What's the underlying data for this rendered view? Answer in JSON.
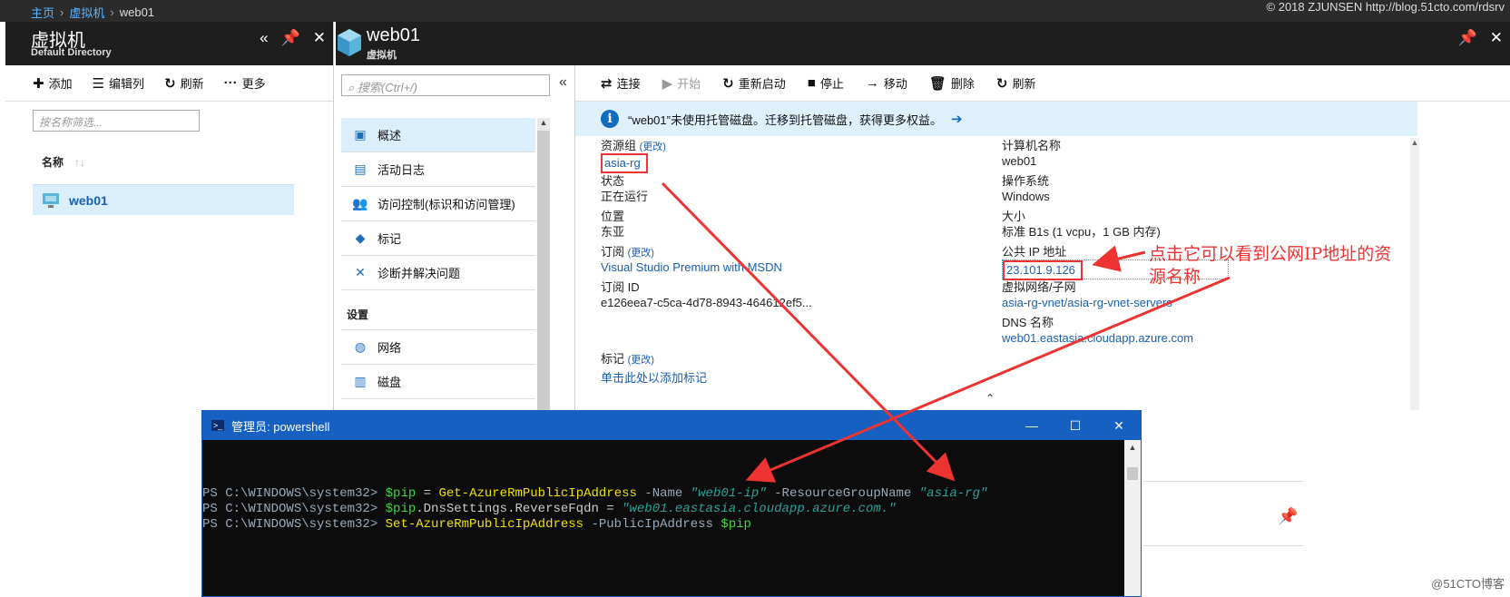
{
  "breadcrumb": [
    "主页",
    "虚拟机",
    "web01"
  ],
  "watermark_top": "© 2018 ZJUNSEN http://blog.51cto.com/rdsrv",
  "vm_list_blade": {
    "title": "虚拟机",
    "subtitle": "Default Directory",
    "toolbar": [
      {
        "icon": "plus-icon",
        "glyph": "✚",
        "label": "添加"
      },
      {
        "icon": "columns-icon",
        "glyph": "☰",
        "label": "编辑列"
      },
      {
        "icon": "refresh-icon",
        "glyph": "↻",
        "label": "刷新"
      },
      {
        "icon": "more-icon",
        "glyph": "···",
        "label": "更多"
      }
    ],
    "filter_placeholder": "按名称筛选...",
    "column_header": "名称",
    "sort_glyph": "↑↓",
    "rows": [
      {
        "name": "web01"
      }
    ]
  },
  "vm_blade": {
    "title": "web01",
    "subtitle": "虚拟机",
    "search_placeholder": "搜索(Ctrl+/)",
    "menu": [
      {
        "icon": "overview-icon",
        "glyph": "▣",
        "label": "概述",
        "active": true
      },
      {
        "icon": "activity-log-icon",
        "glyph": "▤",
        "label": "活动日志"
      },
      {
        "icon": "access-control-icon",
        "glyph": "👥",
        "label": "访问控制(标识和访问管理)"
      },
      {
        "icon": "tag-icon",
        "glyph": "◆",
        "label": "标记"
      },
      {
        "icon": "diagnose-icon",
        "glyph": "✕",
        "label": "诊断并解决问题"
      }
    ],
    "settings_section": "设置",
    "settings_menu": [
      {
        "icon": "network-icon",
        "glyph": "◍",
        "label": "网络"
      },
      {
        "icon": "disk-icon",
        "glyph": "▥",
        "label": "磁盘"
      }
    ],
    "toolbar": [
      {
        "icon": "connect-icon",
        "glyph": "⇄",
        "label": "连接",
        "disabled": false
      },
      {
        "icon": "start-icon",
        "glyph": "▶",
        "label": "开始",
        "disabled": true
      },
      {
        "icon": "restart-icon",
        "glyph": "↻",
        "label": "重新启动",
        "disabled": false
      },
      {
        "icon": "stop-icon",
        "glyph": "■",
        "label": "停止",
        "disabled": false
      },
      {
        "icon": "move-icon",
        "glyph": "→",
        "label": "移动",
        "disabled": false
      },
      {
        "icon": "delete-icon",
        "glyph": "🗑",
        "label": "删除",
        "disabled": false
      },
      {
        "icon": "refresh-icon",
        "glyph": "↻",
        "label": "刷新",
        "disabled": false
      }
    ],
    "notice": "“web01”未使用托管磁盘。迁移到托管磁盘，获得更多权益。",
    "change_link": "(更改)",
    "left_props": {
      "resource_group_label": "资源组",
      "resource_group": "asia-rg",
      "status_label": "状态",
      "status": "正在运行",
      "location_label": "位置",
      "location": "东亚",
      "subscription_label": "订阅",
      "subscription": "Visual Studio Premium with MSDN",
      "subscription_id_label": "订阅 ID",
      "subscription_id": "e126eea7-c5ca-4d78-8943-464612ef5..."
    },
    "right_props": {
      "computer_name_label": "计算机名称",
      "computer_name": "web01",
      "os_label": "操作系统",
      "os": "Windows",
      "size_label": "大小",
      "size": "标准 B1s (1 vcpu，1 GB 内存)",
      "public_ip_label": "公共 IP 地址",
      "public_ip": "23.101.9.126",
      "vnet_label": "虚拟网络/子网",
      "vnet": "asia-rg-vnet/asia-rg-vnet-servers",
      "dns_label": "DNS 名称",
      "dns": "web01.eastasia.cloudapp.azure.com"
    },
    "tags_label": "标记",
    "add_tags_link": "单击此处以添加标记"
  },
  "annotation": [
    "点击它可以看到公网IP地址的资",
    "源名称"
  ],
  "powershell": {
    "title": "管理员: powershell",
    "lines": [
      [
        {
          "t": "PS C:\\WINDOWS\\system32> ",
          "c": "p"
        },
        {
          "t": "$pip",
          "c": "v"
        },
        {
          "t": " = ",
          "c": "g"
        },
        {
          "t": "Get-AzureRmPublicIpAddress",
          "c": "y"
        },
        {
          "t": " -Name ",
          "c": "p"
        },
        {
          "t": "\"web01-ip\"",
          "c": "s"
        },
        {
          "t": " -ResourceGroupName ",
          "c": "p"
        },
        {
          "t": "\"asia-rg\"",
          "c": "s"
        }
      ],
      [
        {
          "t": "PS C:\\WINDOWS\\system32> ",
          "c": "p"
        },
        {
          "t": "$pip",
          "c": "v"
        },
        {
          "t": ".DnsSettings.ReverseFqdn = ",
          "c": "g"
        },
        {
          "t": "\"web01.eastasia.cloudapp.azure.com.\"",
          "c": "s"
        }
      ],
      [
        {
          "t": "PS C:\\WINDOWS\\system32> ",
          "c": "p"
        },
        {
          "t": "Set-AzureRmPublicIpAddress",
          "c": "y"
        },
        {
          "t": " -PublicIpAddress ",
          "c": "p"
        },
        {
          "t": "$pip",
          "c": "v"
        }
      ]
    ]
  },
  "watermark_bottom": "@51CTO博客",
  "colors": {
    "accent": "#0f6cbd",
    "annotation": "#ee3333",
    "header_bg": "#1e1e1e"
  }
}
